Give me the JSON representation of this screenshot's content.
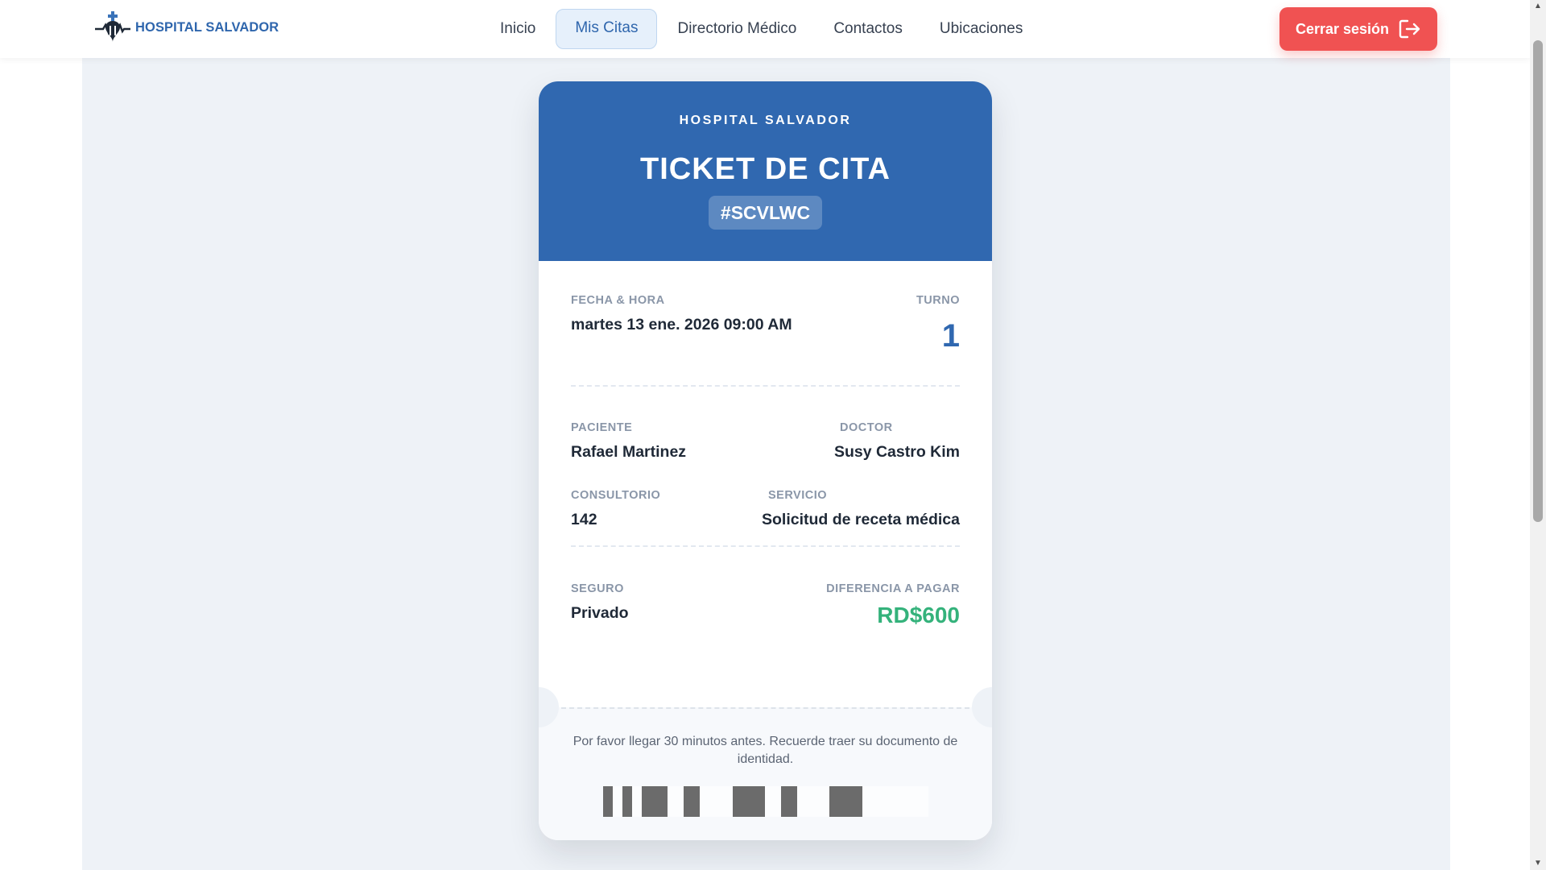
{
  "navbar": {
    "brand": {
      "name": "HOSPITAL SALVADOR",
      "logo_icon": "hospital-logo-icon"
    },
    "items": [
      {
        "label": "Inicio",
        "active": false
      },
      {
        "label": "Mis Citas",
        "active": true
      },
      {
        "label": "Directorio Médico",
        "active": false
      },
      {
        "label": "Contactos",
        "active": false
      },
      {
        "label": "Ubicaciones",
        "active": false
      }
    ],
    "logout": {
      "label": "Cerrar sesión",
      "icon": "logout-icon",
      "color": "#f05252"
    }
  },
  "ticket": {
    "hospital": "HOSPITAL SALVADOR",
    "title": "TICKET DE CITA",
    "code": "#SCVLWC",
    "header_color": "#3068b0",
    "fecha_hora": {
      "label": "FECHA & HORA",
      "value": "martes 13 ene. 2026 09:00 AM"
    },
    "turno": {
      "label": "TURNO",
      "value": "1"
    },
    "paciente": {
      "label": "PACIENTE",
      "value": "Rafael Martinez"
    },
    "doctor": {
      "label": "DOCTOR",
      "value": "Susy Castro Kim"
    },
    "consultorio": {
      "label": "CONSULTORIO",
      "value": "142"
    },
    "servicio": {
      "label": "SERVICIO",
      "value": "Solicitud de receta médica"
    },
    "seguro": {
      "label": "SEGURO",
      "value": "Privado"
    },
    "diferencia": {
      "label": "DIFERENCIA A PAGAR",
      "value": "RD$600",
      "color": "#34b27b"
    },
    "note": "Por favor llegar 30 minutos antes. Recuerde traer su documento de identidad.",
    "barcode_icon": "barcode"
  }
}
